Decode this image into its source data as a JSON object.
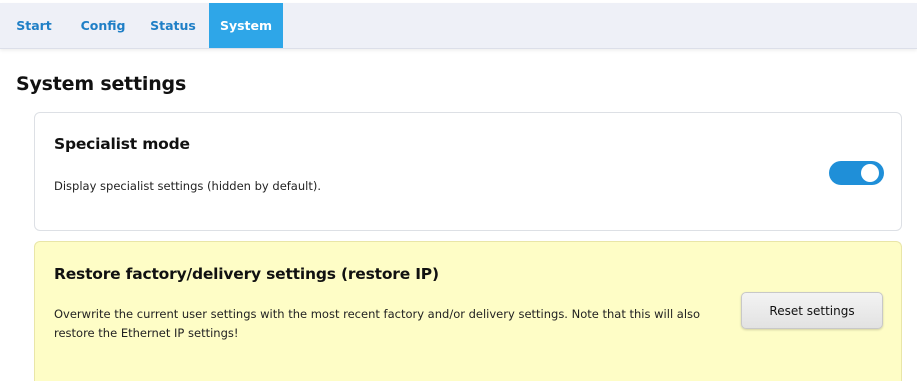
{
  "nav": {
    "tabs": [
      {
        "label": "Start",
        "active": false
      },
      {
        "label": "Config",
        "active": false
      },
      {
        "label": "Status",
        "active": false
      },
      {
        "label": "System",
        "active": true
      }
    ]
  },
  "page": {
    "title": "System settings"
  },
  "specialist": {
    "title": "Specialist mode",
    "description": "Display specialist settings (hidden by default).",
    "toggle_on": true
  },
  "restore": {
    "title": "Restore factory/delivery settings (restore IP)",
    "description": "Overwrite the current user settings with the most recent factory and/or delivery settings. Note that this will also restore the Ethernet IP settings!",
    "button_label": "Reset settings"
  },
  "colors": {
    "accent": "#2ea6e8",
    "toggle": "#1f8fd8",
    "warning_card": "#fefdc6",
    "navbar": "#eef0f7"
  }
}
